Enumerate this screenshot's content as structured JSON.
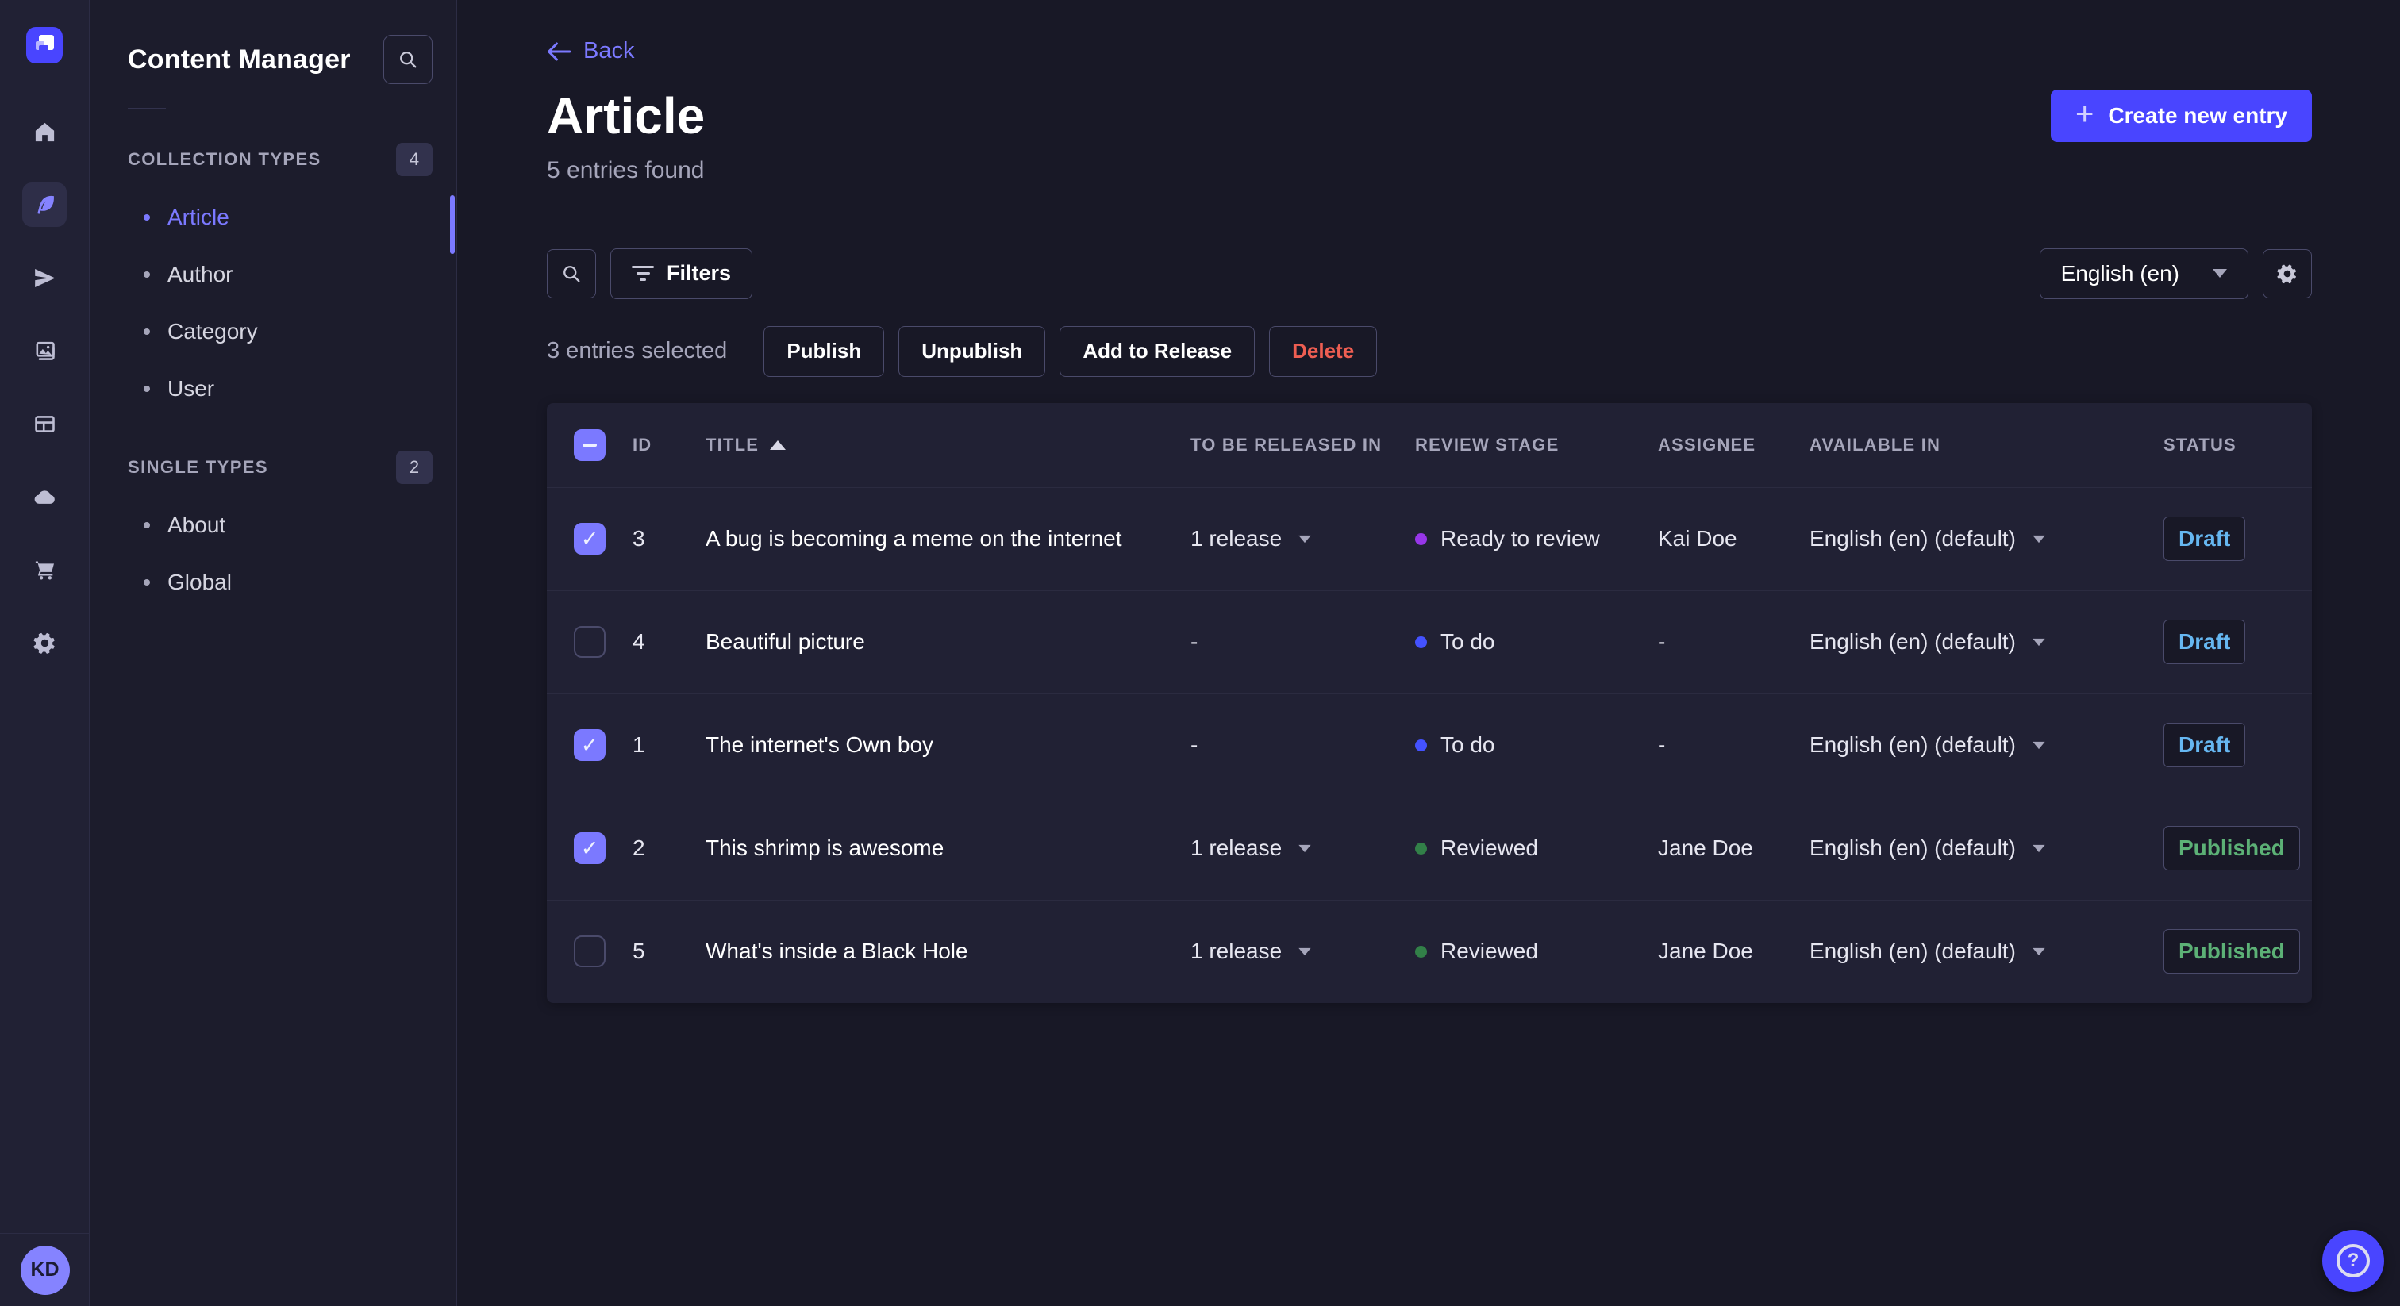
{
  "nav": {
    "items": [
      {
        "name": "home"
      },
      {
        "name": "content-manager",
        "active": true
      },
      {
        "name": "releases"
      },
      {
        "name": "media-library"
      },
      {
        "name": "content-type-builder"
      },
      {
        "name": "deploy"
      },
      {
        "name": "marketplace"
      },
      {
        "name": "settings"
      }
    ],
    "avatar_initials": "KD"
  },
  "subnav": {
    "title": "Content Manager",
    "sections": [
      {
        "label": "COLLECTION TYPES",
        "count": "4",
        "items": [
          {
            "label": "Article",
            "active": true
          },
          {
            "label": "Author"
          },
          {
            "label": "Category"
          },
          {
            "label": "User"
          }
        ]
      },
      {
        "label": "SINGLE TYPES",
        "count": "2",
        "items": [
          {
            "label": "About"
          },
          {
            "label": "Global"
          }
        ]
      }
    ]
  },
  "header": {
    "back_label": "Back",
    "title": "Article",
    "subtitle": "5 entries found",
    "create_button": "Create new entry"
  },
  "toolbar": {
    "filters_label": "Filters",
    "locale_selected": "English (en)"
  },
  "selection": {
    "text": "3 entries selected",
    "actions": [
      "Publish",
      "Unpublish",
      "Add to Release",
      "Delete"
    ]
  },
  "table": {
    "header_checkbox": "indeterminate",
    "columns": [
      "ID",
      "TITLE",
      "TO BE RELEASED IN",
      "REVIEW STAGE",
      "ASSIGNEE",
      "AVAILABLE IN",
      "STATUS"
    ],
    "sort": {
      "column": "TITLE",
      "direction": "asc"
    },
    "rows": [
      {
        "checked": true,
        "id": "3",
        "title": "A bug is becoming a meme on the internet",
        "released_in": "1 release",
        "review_stage": "Ready to review",
        "review_color": "#9736e8",
        "assignee": "Kai Doe",
        "available_in": "English (en) (default)",
        "status": "Draft"
      },
      {
        "checked": false,
        "id": "4",
        "title": "Beautiful picture",
        "released_in": "-",
        "review_stage": "To do",
        "review_color": "#4452ff",
        "assignee": "-",
        "available_in": "English (en) (default)",
        "status": "Draft"
      },
      {
        "checked": true,
        "id": "1",
        "title": "The internet's Own boy",
        "released_in": "-",
        "review_stage": "To do",
        "review_color": "#4452ff",
        "assignee": "-",
        "available_in": "English (en) (default)",
        "status": "Draft"
      },
      {
        "checked": true,
        "id": "2",
        "title": "This shrimp is awesome",
        "released_in": "1 release",
        "review_stage": "Reviewed",
        "review_color": "#328048",
        "assignee": "Jane Doe",
        "available_in": "English (en) (default)",
        "status": "Published"
      },
      {
        "checked": false,
        "id": "5",
        "title": "What's inside a Black Hole",
        "released_in": "1 release",
        "review_stage": "Reviewed",
        "review_color": "#328048",
        "assignee": "Jane Doe",
        "available_in": "English (en) (default)",
        "status": "Published"
      }
    ]
  },
  "help": {
    "glyph": "?"
  },
  "colors": {
    "primary": "#4945ff",
    "primary_light": "#7b79ff",
    "danger": "#ee5e52",
    "status": {
      "draft": "#66b7f1",
      "published": "#5cb176"
    },
    "review_dots": {
      "ready_to_review": "#9736e8",
      "to_do": "#4452ff",
      "reviewed": "#328048"
    }
  }
}
